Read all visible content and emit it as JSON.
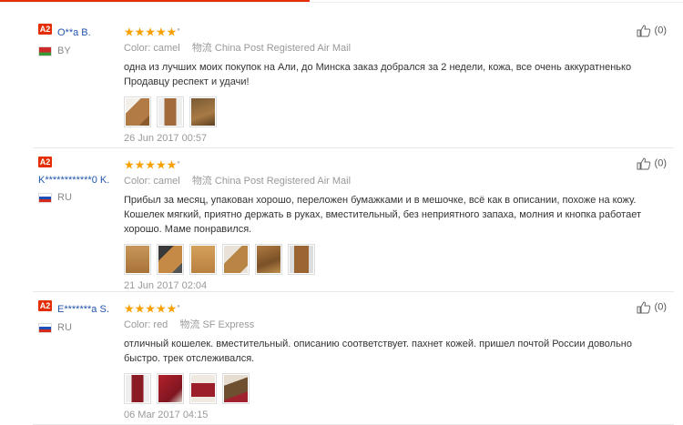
{
  "reviews": [
    {
      "level": "A2",
      "user": "O**a B.",
      "country": "BY",
      "stars": "★★★★★",
      "color_label": "Color:",
      "color_value": "camel",
      "ship_label": "物流",
      "ship_value": "China Post Registered Air Mail",
      "text": "одна из лучших моих покупок на Али, до Минска заказ добрался за 2 недели, кожа, все очень аккуратненько Продавцу респект и удачи!",
      "date": "26 Jun 2017 00:57",
      "likes": "(0)"
    },
    {
      "level": "A2",
      "user": "K************0 K.",
      "country": "RU",
      "stars": "★★★★★",
      "color_label": "Color:",
      "color_value": "camel",
      "ship_label": "物流",
      "ship_value": "China Post Registered Air Mail",
      "text": "Прибыл за месяц, упакован хорошо, переложен бумажками и в мешочке, всё как в описании, похоже на кожу. Кошелек мягкий, приятно держать в руках, вместительный, без неприятного запаха, молния и кнопка работает хорошо. Маме понравился.",
      "date": "21 Jun 2017 02:04",
      "likes": "(0)"
    },
    {
      "level": "A2",
      "user": "E*******a S.",
      "country": "RU",
      "stars": "★★★★★",
      "color_label": "Color:",
      "color_value": "red",
      "ship_label": "物流",
      "ship_value": "SF Express",
      "text": "отличный кошелек. вместительный. описанию соответствует. пахнет кожей. пришел почтой России довольно быстро. трек отслеживался.",
      "date": "06 Mar 2017 04:15",
      "likes": "(0)"
    }
  ],
  "colors": {
    "accent": "#e62e04",
    "username": "#2255aa",
    "star": "#f7a000"
  }
}
